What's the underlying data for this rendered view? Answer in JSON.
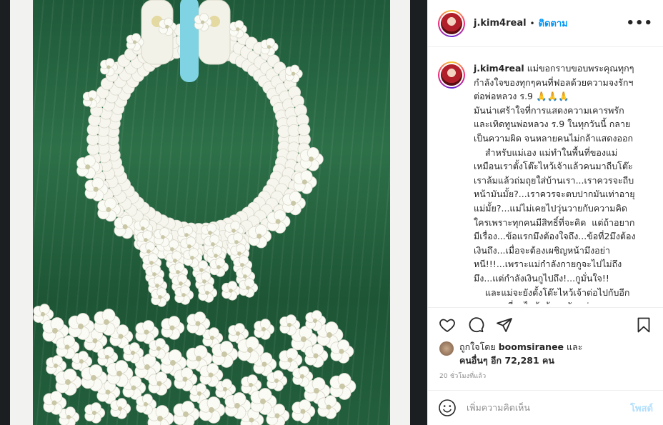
{
  "post": {
    "username": "j.kim4real",
    "separator": "•",
    "follow_label": "ติดตาม",
    "more_label": "•••",
    "caption": {
      "username": "j.kim4real",
      "text": " แม่ขอกราบขอบพระคุณทุกๆ\nกำลังใจของทุกๆคนที่ฟอลด้วยความจงรักฯ\nต่อพ่อหลวง ร.9 🙏🙏🙏\nมันน่าเศร้าใจที่การแสดงความเคารพรัก\nและเทิดทูนพ่อหลวง ร.9 ในทุกวันนี้ กลาย\nเป็นความผิด จนหลายคนไม่กล้าแสดงออก\n    สำหรับแม่เอง แม่ทำในพื้นที่ของแม่\nเหมือนเราตั้งโต๊ะไหว้เจ้าแล้วคนมาถีบโต๊ะ\nเราล้มแล้วถ่มถุยใส่บ้านเรา...เราควรจะถีบ\nหน้ามันมั้ย?...เราควรจะตบปากมันเท่าอายุ\nแม่มั้ย?...แม่ไม่เคยไปวุ่นวายกับความคิด\nใครเพราะทุกคนมีสิทธิ์ที่จะคิด  แต่ถ้าอยาก\nมีเรื่อง...ข้อแรกมึงต้องใจถึง...ข้อที่2มึงต้อง\nเงินถึง...เมื่อจะต้องเผชิญหน้ามึงอย่า\nหนี!!!...เพราะแม่กำลังกายกูจะไปไม่ถึง\nมึง...แต่กำลังเงินกูไปถึง!...กูมั่นใจ!!\n    และแม่จะยังตั้งโต๊ะไหว้เจ้าต่อไปกับอีก\nหลายคนที่มาไหว้พร้อมๆกับแม่\nด้วยความจงรักหวงแหนฯ"
    },
    "likes": {
      "prefix": "ถูกใจโดย ",
      "user": "boomsiranee",
      "middle": " และ",
      "others": "คนอื่นๆ อีก 72,281 คน"
    },
    "time": "20 ชั่วโมงที่แล้ว",
    "comment_placeholder": "เพิ่มความคิดเห็น",
    "post_button": "โพสต์"
  },
  "icons": {
    "like": "heart-icon",
    "comment": "comment-bubble-icon",
    "share": "paper-plane-icon",
    "save": "bookmark-icon",
    "emoji": "smiley-icon"
  },
  "colors": {
    "link": "#0095f6",
    "post_disabled": "#b2dffc",
    "muted": "#8e8e8e",
    "ribbon": "#7fd3e3"
  }
}
